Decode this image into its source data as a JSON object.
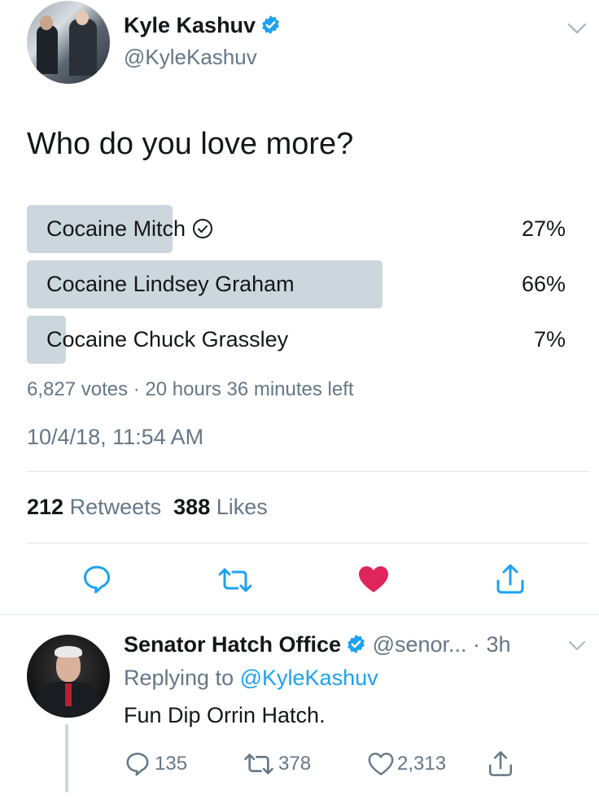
{
  "tweet": {
    "author_name": "Kyle Kashuv",
    "author_handle": "@KyleKashuv",
    "text": "Who do you love more?",
    "poll": {
      "options": [
        {
          "label": "Cocaine Mitch",
          "percent_label": "27%",
          "percent": 27,
          "selected": true
        },
        {
          "label": "Cocaine Lindsey Graham",
          "percent_label": "66%",
          "percent": 66,
          "selected": false
        },
        {
          "label": "Cocaine Chuck Grassley",
          "percent_label": "7%",
          "percent": 7,
          "selected": false
        }
      ],
      "summary": "6,827 votes · 20 hours 36 minutes left"
    },
    "timestamp": "10/4/18, 11:54 AM",
    "retweets_count": "212",
    "retweets_label": "Retweets",
    "likes_count": "388",
    "likes_label": "Likes",
    "liked": true
  },
  "reply": {
    "author_name": "Senator Hatch Office",
    "meta": "@senor... · 3h",
    "replying_prefix": "Replying to",
    "replying_to": "@KyleKashuv",
    "text": "Fun Dip Orrin Hatch.",
    "reply_count": "135",
    "retweet_count": "378",
    "like_count": "2,313"
  },
  "colors": {
    "accent": "#1da1f2",
    "like": "#e0245e",
    "poll_bar": "#ccd6dd",
    "muted": "#657786"
  },
  "icons": [
    "verified-badge-icon",
    "chevron-down-icon",
    "check-circle-icon",
    "reply-icon",
    "retweet-icon",
    "heart-icon",
    "share-icon"
  ]
}
